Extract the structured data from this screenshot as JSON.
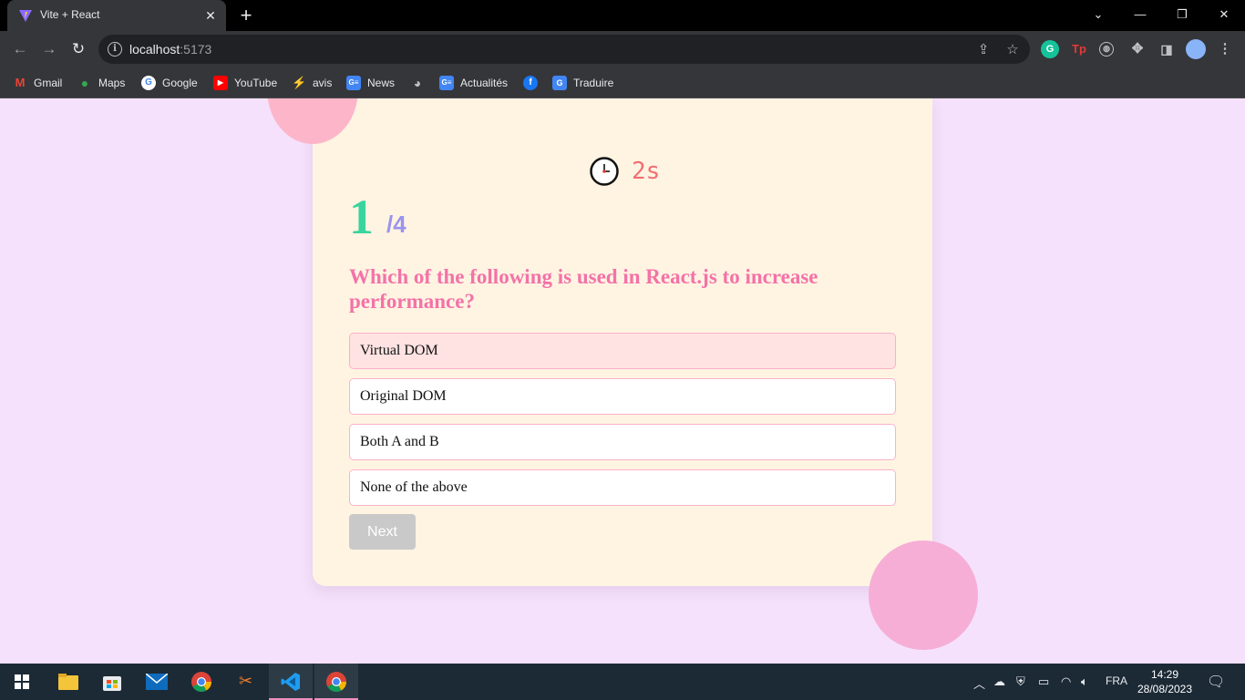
{
  "browser": {
    "tab_title": "Vite + React",
    "url_host": "localhost",
    "url_port": ":5173",
    "bookmarks": [
      {
        "label": "Gmail",
        "icon": "gmail-icon",
        "color": "#ea4335"
      },
      {
        "label": "Maps",
        "icon": "maps-icon",
        "color": "#34a853"
      },
      {
        "label": "Google",
        "icon": "google-icon",
        "color": "#ffffff"
      },
      {
        "label": "YouTube",
        "icon": "youtube-icon",
        "color": "#ff0000"
      },
      {
        "label": "avis",
        "icon": "avis-icon",
        "color": "#c9a227"
      },
      {
        "label": "News",
        "icon": "news-icon",
        "color": "#4285f4"
      },
      {
        "label": "",
        "icon": "globe-icon",
        "color": "#9aa0a6"
      },
      {
        "label": "Actualités",
        "icon": "news-icon",
        "color": "#4285f4"
      },
      {
        "label": "",
        "icon": "facebook-icon",
        "color": "#1877f2"
      },
      {
        "label": "Traduire",
        "icon": "translate-icon",
        "color": "#4285f4"
      }
    ]
  },
  "quiz": {
    "timer": "2s",
    "current": "1",
    "total": "/4",
    "question": "Which of the following is used in React.js to increase performance?",
    "options": [
      "Virtual DOM",
      "Original DOM",
      "Both A and B",
      "None of the above"
    ],
    "selected_index": 0,
    "next_label": "Next"
  },
  "colors": {
    "page_bg": "#f5e1fb",
    "card_bg": "#fff4e2",
    "question": "#f472a8",
    "current_number": "#3ad49e",
    "total_number": "#9b93ee",
    "timer": "#f06f73",
    "option_border": "#f9b2c9",
    "selected_option_bg": "#ffe2e2",
    "next_disabled_bg": "#c9c9c9"
  },
  "taskbar": {
    "language": "FRA",
    "time": "14:29",
    "date": "28/08/2023"
  }
}
